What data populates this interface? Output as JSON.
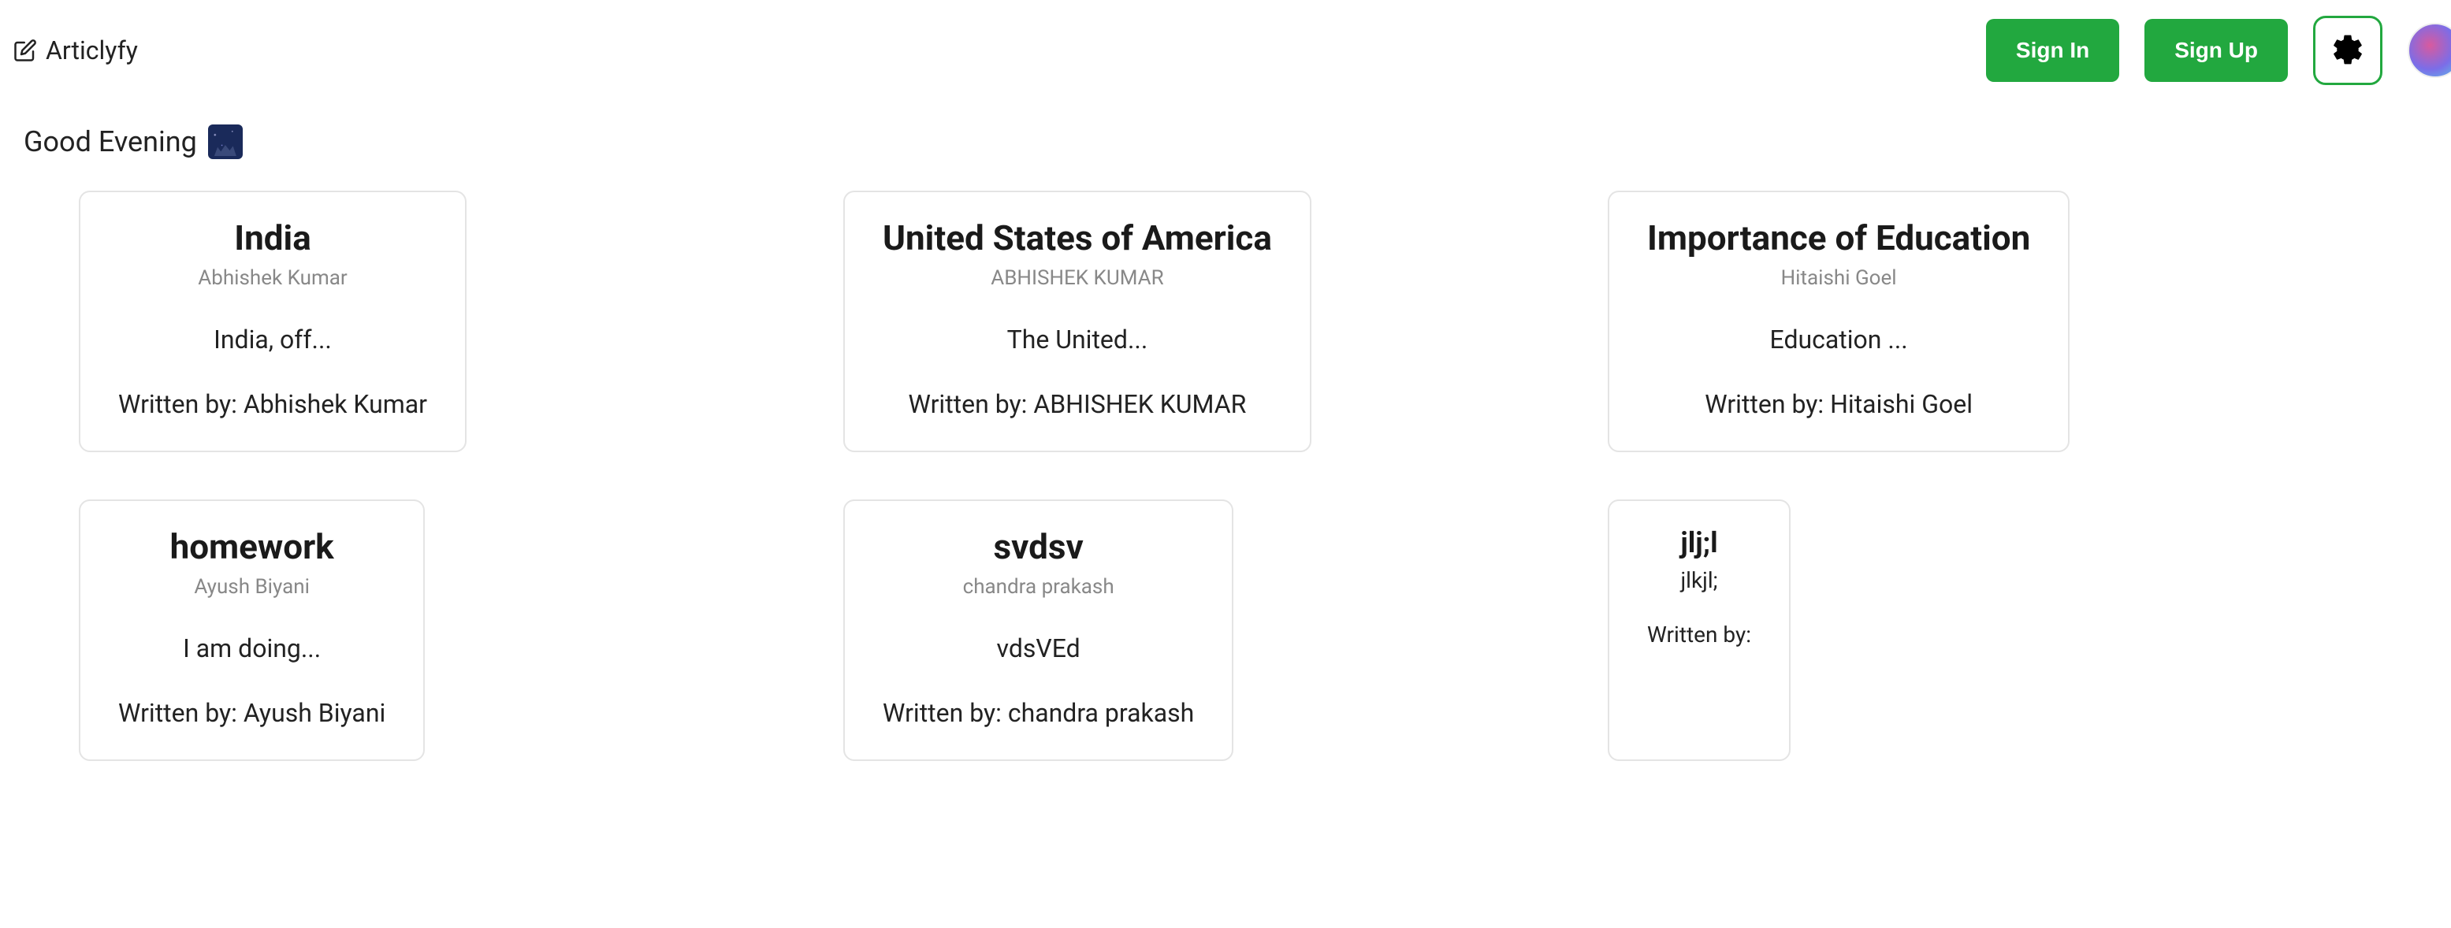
{
  "header": {
    "brand": "Articlyfy",
    "sign_in": "Sign In",
    "sign_up": "Sign Up"
  },
  "greeting": {
    "text": "Good Evening"
  },
  "cards": [
    {
      "title": "India",
      "author": "Abhishek Kumar",
      "excerpt": "India, off...",
      "byline_prefix": "Written by: ",
      "byline_name": "Abhishek Kumar"
    },
    {
      "title": "United States of America",
      "author": "ABHISHEK KUMAR",
      "excerpt": "The United...",
      "byline_prefix": "Written by: ",
      "byline_name": "ABHISHEK KUMAR"
    },
    {
      "title": "Importance of Education",
      "author": "Hitaishi Goel",
      "excerpt": "Education ...",
      "byline_prefix": "Written by: ",
      "byline_name": "Hitaishi Goel"
    },
    {
      "title": "homework",
      "author": "Ayush Biyani",
      "excerpt": "I am doing...",
      "byline_prefix": "Written by: ",
      "byline_name": "Ayush Biyani"
    },
    {
      "title": "svdsv",
      "author": "chandra prakash",
      "excerpt": "vdsVEd",
      "byline_prefix": "Written by: ",
      "byline_name": "chandra prakash"
    },
    {
      "title": "jlj;l",
      "author": "",
      "excerpt": "jlkjl;",
      "byline_prefix": "Written by: ",
      "byline_name": ""
    }
  ]
}
